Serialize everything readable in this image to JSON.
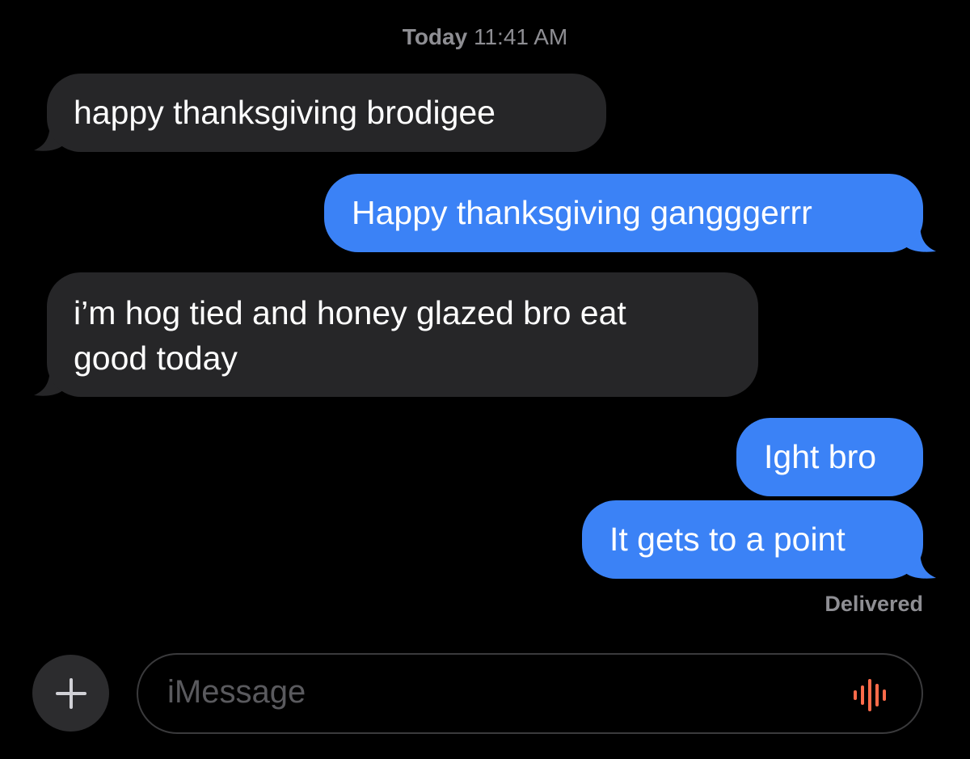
{
  "header": {
    "day": "Today",
    "time": "11:41 AM"
  },
  "messages": [
    {
      "direction": "received",
      "lines": [
        "happy thanksgiving brodigee"
      ]
    },
    {
      "direction": "sent",
      "lines": [
        "Happy thanksgiving gangggerrr"
      ]
    },
    {
      "direction": "received",
      "lines": [
        "i’m hog tied and honey glazed bro eat",
        "good today"
      ]
    },
    {
      "direction": "sent",
      "lines": [
        "Ight bro"
      ]
    },
    {
      "direction": "sent",
      "lines": [
        "It gets to a point"
      ]
    }
  ],
  "status": {
    "delivered": "Delivered"
  },
  "composer": {
    "placeholder": "iMessage",
    "plus_icon": "plus-icon",
    "audio_icon": "audio-waveform-icon"
  },
  "colors": {
    "background": "#000000",
    "received_bubble": "#262628",
    "sent_bubble": "#3b82f6",
    "secondary_text": "#8e8e93",
    "audio_icon": "#ff6b4a"
  }
}
